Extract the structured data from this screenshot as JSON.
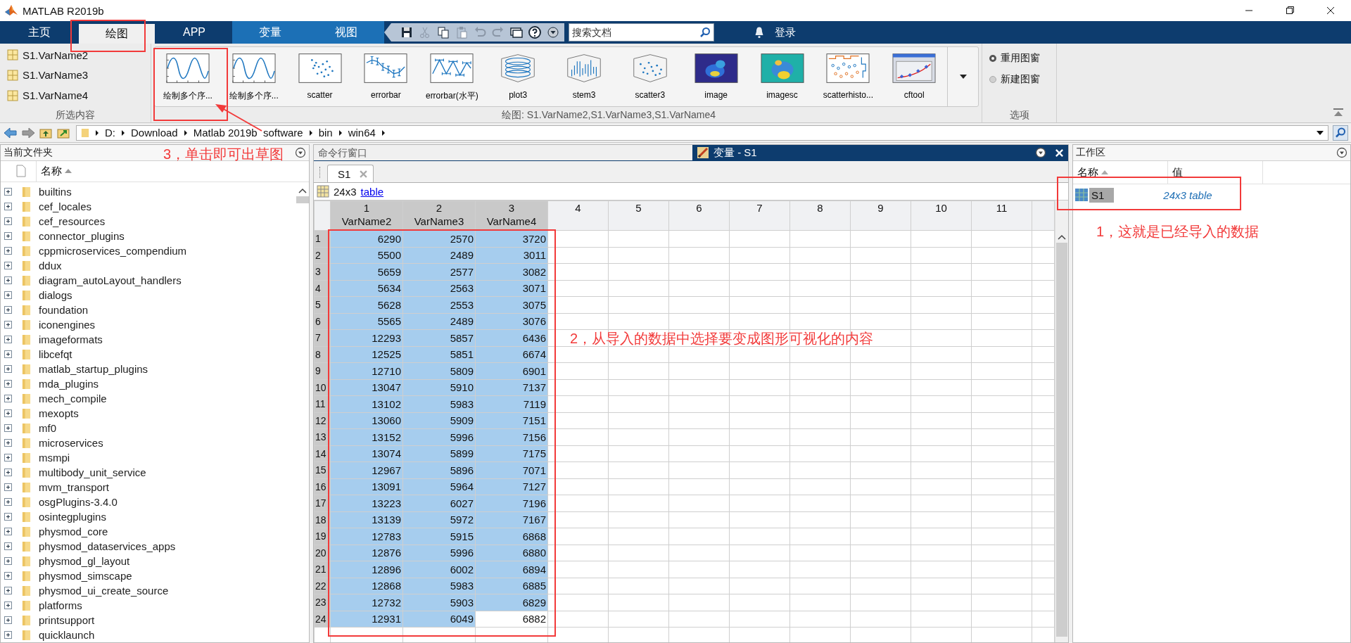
{
  "window": {
    "title": "MATLAB R2019b"
  },
  "tabs": [
    {
      "label": "主页",
      "selected": false,
      "contextual": false
    },
    {
      "label": "绘图",
      "selected": true,
      "contextual": false
    },
    {
      "label": "APP",
      "selected": false,
      "contextual": false
    },
    {
      "label": "变量",
      "selected": false,
      "contextual": true
    },
    {
      "label": "视图",
      "selected": false,
      "contextual": true
    }
  ],
  "quick_access": {
    "buttons": [
      {
        "kind": "save",
        "disabled": false
      },
      {
        "kind": "cut",
        "disabled": true
      },
      {
        "kind": "copy",
        "disabled": false
      },
      {
        "kind": "paste",
        "disabled": true
      },
      {
        "kind": "undo",
        "disabled": true
      },
      {
        "kind": "redo",
        "disabled": true
      },
      {
        "kind": "windows",
        "disabled": false
      },
      {
        "kind": "help",
        "disabled": false
      },
      {
        "kind": "customize",
        "disabled": false
      }
    ],
    "search": {
      "placeholder": "搜索文档"
    },
    "sign_in": "登录"
  },
  "ribbon": {
    "selection": {
      "items": [
        "S1.VarName2",
        "S1.VarName3",
        "S1.VarName4"
      ],
      "caption": "所选内容"
    },
    "gallery": {
      "items": [
        {
          "label": "绘制多个序...",
          "kind": "sine"
        },
        {
          "label": "绘制多个序...",
          "kind": "sine"
        },
        {
          "label": "scatter",
          "kind": "scatter"
        },
        {
          "label": "errorbar",
          "kind": "errorbar"
        },
        {
          "label": "errorbar(水平)",
          "kind": "errorbarh"
        },
        {
          "label": "plot3",
          "kind": "plot3"
        },
        {
          "label": "stem3",
          "kind": "stem3"
        },
        {
          "label": "scatter3",
          "kind": "scatter3"
        },
        {
          "label": "image",
          "kind": "image"
        },
        {
          "label": "imagesc",
          "kind": "imagesc"
        },
        {
          "label": "scatterhisto...",
          "kind": "scatterhist"
        },
        {
          "label": "cftool",
          "kind": "cftool"
        }
      ],
      "caption": "绘图: S1.VarName2,S1.VarName3,S1.VarName4"
    },
    "options": {
      "radios": [
        {
          "label": "重用图窗",
          "selected": true
        },
        {
          "label": "新建图窗",
          "selected": false
        }
      ],
      "caption": "选项"
    }
  },
  "address_bar": {
    "path": [
      "D:",
      "Download",
      "Matlab 2019b  software",
      "bin",
      "win64"
    ]
  },
  "current_folder": {
    "title": "当前文件夹",
    "column": "名称",
    "items": [
      "builtins",
      "cef_locales",
      "cef_resources",
      "connector_plugins",
      "cppmicroservices_compendium",
      "ddux",
      "diagram_autoLayout_handlers",
      "dialogs",
      "foundation",
      "iconengines",
      "imageformats",
      "libcefqt",
      "matlab_startup_plugins",
      "mda_plugins",
      "mech_compile",
      "mexopts",
      "mf0",
      "microservices",
      "msmpi",
      "multibody_unit_service",
      "mvm_transport",
      "osgPlugins-3.4.0",
      "osintegplugins",
      "physmod_core",
      "physmod_dataservices_apps",
      "physmod_gl_layout",
      "physmod_simscape",
      "physmod_ui_create_source",
      "platforms",
      "printsupport",
      "quicklaunch"
    ]
  },
  "command_window": {
    "title": "命令行窗口"
  },
  "variables_editor": {
    "title": "变量 - S1",
    "tabs": [
      {
        "label": "S1",
        "selected": true
      }
    ],
    "size": "24x3",
    "class_link": "table",
    "columns": [
      {
        "number": "1",
        "name": "VarName2",
        "selected": true
      },
      {
        "number": "2",
        "name": "VarName3",
        "selected": true
      },
      {
        "number": "3",
        "name": "VarName4",
        "selected": true
      },
      {
        "number": "4",
        "selected": false
      },
      {
        "number": "5",
        "selected": false
      },
      {
        "number": "6",
        "selected": false
      },
      {
        "number": "7",
        "selected": false
      },
      {
        "number": "8",
        "selected": false
      },
      {
        "number": "9",
        "selected": false
      },
      {
        "number": "10",
        "selected": false
      },
      {
        "number": "11",
        "selected": false
      }
    ],
    "rows": [
      {
        "index": "1",
        "selected": true,
        "cells": [
          {
            "value": "6290",
            "selected": true
          },
          {
            "value": "2570",
            "selected": true
          },
          {
            "value": "3720",
            "selected": true
          }
        ]
      },
      {
        "index": "2",
        "selected": true,
        "cells": [
          {
            "value": "5500",
            "selected": true
          },
          {
            "value": "2489",
            "selected": true
          },
          {
            "value": "3011",
            "selected": true
          }
        ]
      },
      {
        "index": "3",
        "selected": true,
        "cells": [
          {
            "value": "5659",
            "selected": true
          },
          {
            "value": "2577",
            "selected": true
          },
          {
            "value": "3082",
            "selected": true
          }
        ]
      },
      {
        "index": "4",
        "selected": true,
        "cells": [
          {
            "value": "5634",
            "selected": true
          },
          {
            "value": "2563",
            "selected": true
          },
          {
            "value": "3071",
            "selected": true
          }
        ]
      },
      {
        "index": "5",
        "selected": true,
        "cells": [
          {
            "value": "5628",
            "selected": true
          },
          {
            "value": "2553",
            "selected": true
          },
          {
            "value": "3075",
            "selected": true
          }
        ]
      },
      {
        "index": "6",
        "selected": true,
        "cells": [
          {
            "value": "5565",
            "selected": true
          },
          {
            "value": "2489",
            "selected": true
          },
          {
            "value": "3076",
            "selected": true
          }
        ]
      },
      {
        "index": "7",
        "selected": true,
        "cells": [
          {
            "value": "12293",
            "selected": true
          },
          {
            "value": "5857",
            "selected": true
          },
          {
            "value": "6436",
            "selected": true
          }
        ]
      },
      {
        "index": "8",
        "selected": true,
        "cells": [
          {
            "value": "12525",
            "selected": true
          },
          {
            "value": "5851",
            "selected": true
          },
          {
            "value": "6674",
            "selected": true
          }
        ]
      },
      {
        "index": "9",
        "selected": true,
        "cells": [
          {
            "value": "12710",
            "selected": true
          },
          {
            "value": "5809",
            "selected": true
          },
          {
            "value": "6901",
            "selected": true
          }
        ]
      },
      {
        "index": "10",
        "selected": true,
        "cells": [
          {
            "value": "13047",
            "selected": true
          },
          {
            "value": "5910",
            "selected": true
          },
          {
            "value": "7137",
            "selected": true
          }
        ]
      },
      {
        "index": "11",
        "selected": true,
        "cells": [
          {
            "value": "13102",
            "selected": true
          },
          {
            "value": "5983",
            "selected": true
          },
          {
            "value": "7119",
            "selected": true
          }
        ]
      },
      {
        "index": "12",
        "selected": true,
        "cells": [
          {
            "value": "13060",
            "selected": true
          },
          {
            "value": "5909",
            "selected": true
          },
          {
            "value": "7151",
            "selected": true
          }
        ]
      },
      {
        "index": "13",
        "selected": true,
        "cells": [
          {
            "value": "13152",
            "selected": true
          },
          {
            "value": "5996",
            "selected": true
          },
          {
            "value": "7156",
            "selected": true
          }
        ]
      },
      {
        "index": "14",
        "selected": true,
        "cells": [
          {
            "value": "13074",
            "selected": true
          },
          {
            "value": "5899",
            "selected": true
          },
          {
            "value": "7175",
            "selected": true
          }
        ]
      },
      {
        "index": "15",
        "selected": true,
        "cells": [
          {
            "value": "12967",
            "selected": true
          },
          {
            "value": "5896",
            "selected": true
          },
          {
            "value": "7071",
            "selected": true
          }
        ]
      },
      {
        "index": "16",
        "selected": true,
        "cells": [
          {
            "value": "13091",
            "selected": true
          },
          {
            "value": "5964",
            "selected": true
          },
          {
            "value": "7127",
            "selected": true
          }
        ]
      },
      {
        "index": "17",
        "selected": true,
        "cells": [
          {
            "value": "13223",
            "selected": true
          },
          {
            "value": "6027",
            "selected": true
          },
          {
            "value": "7196",
            "selected": true
          }
        ]
      },
      {
        "index": "18",
        "selected": true,
        "cells": [
          {
            "value": "13139",
            "selected": true
          },
          {
            "value": "5972",
            "selected": true
          },
          {
            "value": "7167",
            "selected": true
          }
        ]
      },
      {
        "index": "19",
        "selected": true,
        "cells": [
          {
            "value": "12783",
            "selected": true
          },
          {
            "value": "5915",
            "selected": true
          },
          {
            "value": "6868",
            "selected": true
          }
        ]
      },
      {
        "index": "20",
        "selected": true,
        "cells": [
          {
            "value": "12876",
            "selected": true
          },
          {
            "value": "5996",
            "selected": true
          },
          {
            "value": "6880",
            "selected": true
          }
        ]
      },
      {
        "index": "21",
        "selected": true,
        "cells": [
          {
            "value": "12896",
            "selected": true
          },
          {
            "value": "6002",
            "selected": true
          },
          {
            "value": "6894",
            "selected": true
          }
        ]
      },
      {
        "index": "22",
        "selected": true,
        "cells": [
          {
            "value": "12868",
            "selected": true
          },
          {
            "value": "5983",
            "selected": true
          },
          {
            "value": "6885",
            "selected": true
          }
        ]
      },
      {
        "index": "23",
        "selected": true,
        "cells": [
          {
            "value": "12732",
            "selected": true
          },
          {
            "value": "5903",
            "selected": true
          },
          {
            "value": "6829",
            "selected": true
          }
        ]
      },
      {
        "index": "24",
        "selected": true,
        "cells": [
          {
            "value": "12931",
            "selected": true
          },
          {
            "value": "6049",
            "selected": true
          },
          {
            "value": "6882",
            "selected": false
          }
        ]
      }
    ]
  },
  "workspace": {
    "title": "工作区",
    "columns": [
      "名称",
      "值"
    ],
    "items": [
      {
        "name": "S1",
        "value": "24x3 table",
        "selected": true
      }
    ]
  },
  "annotations": [
    "3，单击即可出草图",
    "2，从导入的数据中选择要变成图形可视化的内容",
    "1，这就是已经导入的数据"
  ]
}
